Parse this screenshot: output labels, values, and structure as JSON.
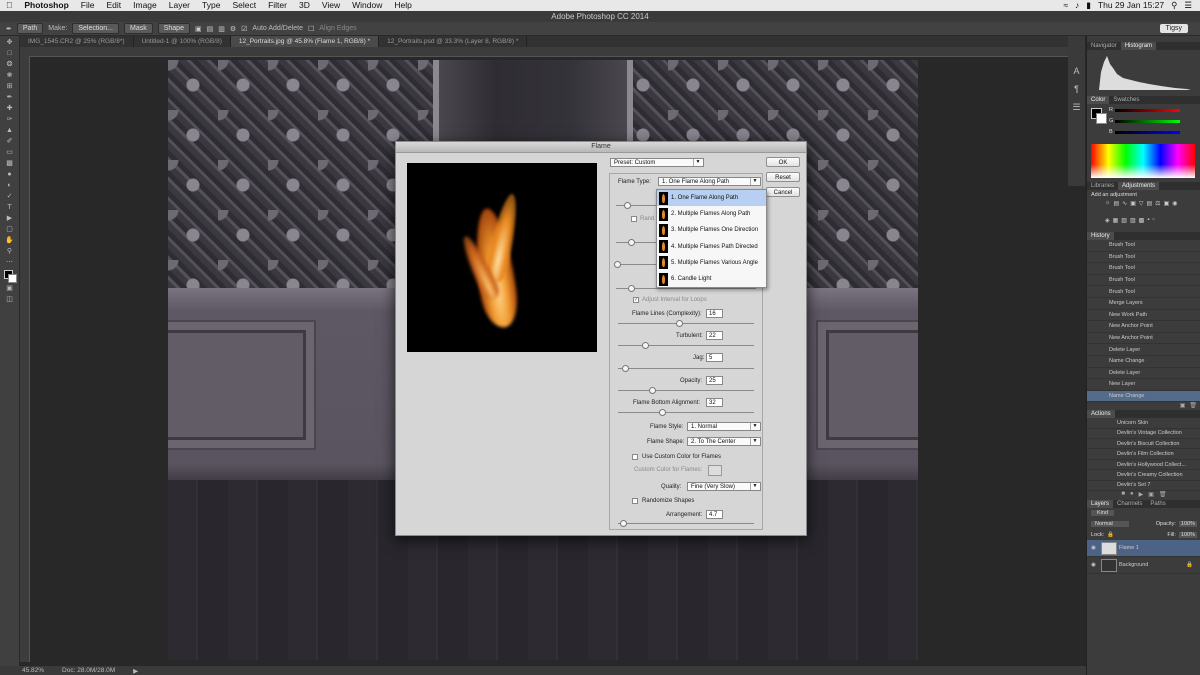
{
  "menubar": {
    "app": "Photoshop",
    "items": [
      "File",
      "Edit",
      "Image",
      "Layer",
      "Type",
      "Select",
      "Filter",
      "3D",
      "View",
      "Window",
      "Help"
    ],
    "clock": "Thu 29 Jan  15:27"
  },
  "window_title": "Adobe Photoshop CC 2014",
  "options_bar": {
    "mode": "Path",
    "make_label": "Make:",
    "selection_btn": "Selection...",
    "mask_btn": "Mask",
    "shape_btn": "Shape",
    "auto_add_delete": "Auto Add/Delete",
    "align_edges": "Align Edges",
    "workspace": "Tigsy"
  },
  "tabs": [
    "IMG_1545.CR2 @ 25% (RGB/8*)",
    "Untitled-1 @ 100% (RGB/8)",
    "12_Portraits.jpg @ 45.8% (Flame 1, RGB/8) *",
    "12_Portraits.psd @ 33.3% (Layer 8, RGB/8) *"
  ],
  "status": {
    "zoom": "45.82%",
    "doc": "Doc: 28.0M/28.0M"
  },
  "dialog": {
    "title": "Flame",
    "preset": "Preset: Custom",
    "ok": "OK",
    "reset": "Reset",
    "cancel": "Cancel",
    "flame_type_label": "Flame Type:",
    "flame_type_value": "1. One Flame Along Path",
    "randomize_label_partial": "Rand",
    "flame_type_options": [
      "1. One Flame Along Path",
      "2. Multiple Flames Along Path",
      "3. Multiple Flames One Direction",
      "4. Multiple Flames Path Directed",
      "5. Multiple Flames Various Angle",
      "6. Candle Light"
    ],
    "adjust_interval": "Adjust Interval for Loops",
    "flame_lines_label": "Flame Lines (Complexity):",
    "flame_lines_value": "16",
    "turbulent_label": "Turbulent:",
    "turbulent_value": "22",
    "jag_label": "Jag:",
    "jag_value": "5",
    "opacity_label": "Opacity:",
    "opacity_value": "25",
    "bottom_align_label": "Flame Bottom Alignment:",
    "bottom_align_value": "32",
    "flame_style_label": "Flame Style:",
    "flame_style_value": "1. Normal",
    "flame_shape_label": "Flame Shape:",
    "flame_shape_value": "2. To The Center",
    "custom_color_check": "Use Custom Color for Flames",
    "custom_color_label": "Custom Color for Flames:",
    "quality_label": "Quality:",
    "quality_value": "Fine (Very Slow)",
    "randomize_shapes": "Randomize Shapes",
    "arrangement_label": "Arrangement:",
    "arrangement_value": "4.7",
    "slider_levels": {
      "flame_lines": 0.45,
      "turbulent": 0.2,
      "jag": 0.05,
      "opacity": 0.25,
      "bottom_align": 0.32,
      "arrangement": 0.04
    }
  },
  "panels": {
    "navigator_tabs": [
      "Navigator",
      "Histogram"
    ],
    "color_tabs": [
      "Color",
      "Swatches"
    ],
    "color_r": "R",
    "color_g": "G",
    "color_b": "B",
    "libraries_tabs": [
      "Libraries",
      "Adjustments"
    ],
    "add_adjustment": "Add an adjustment",
    "history_title": "History",
    "history_items": [
      "Brush Tool",
      "Brush Tool",
      "Brush Tool",
      "Brush Tool",
      "Brush Tool",
      "Merge Layers",
      "New Work Path",
      "New Anchor Point",
      "New Anchor Point",
      "Delete Layer",
      "Name Change",
      "Delete Layer",
      "New Layer",
      "Name Change"
    ],
    "actions_title": "Actions",
    "actions_items": [
      "Unicorn Skin",
      "Devlin's Vintage Collection",
      "Devlin's Biscuit Collection",
      "Devlin's Film Collection",
      "Devlin's Hollywood Collect...",
      "Devlin's Creamy Collection",
      "Devlin's Set 7"
    ],
    "layers_tabs": [
      "Layers",
      "Channels",
      "Paths"
    ],
    "kind": "Kind",
    "blend_mode": "Normal",
    "opacity_label": "Opacity:",
    "opacity_value": "100%",
    "lock_label": "Lock:",
    "fill_label": "Fill:",
    "fill_value": "100%",
    "layers": [
      "Flame 1",
      "Background"
    ]
  }
}
